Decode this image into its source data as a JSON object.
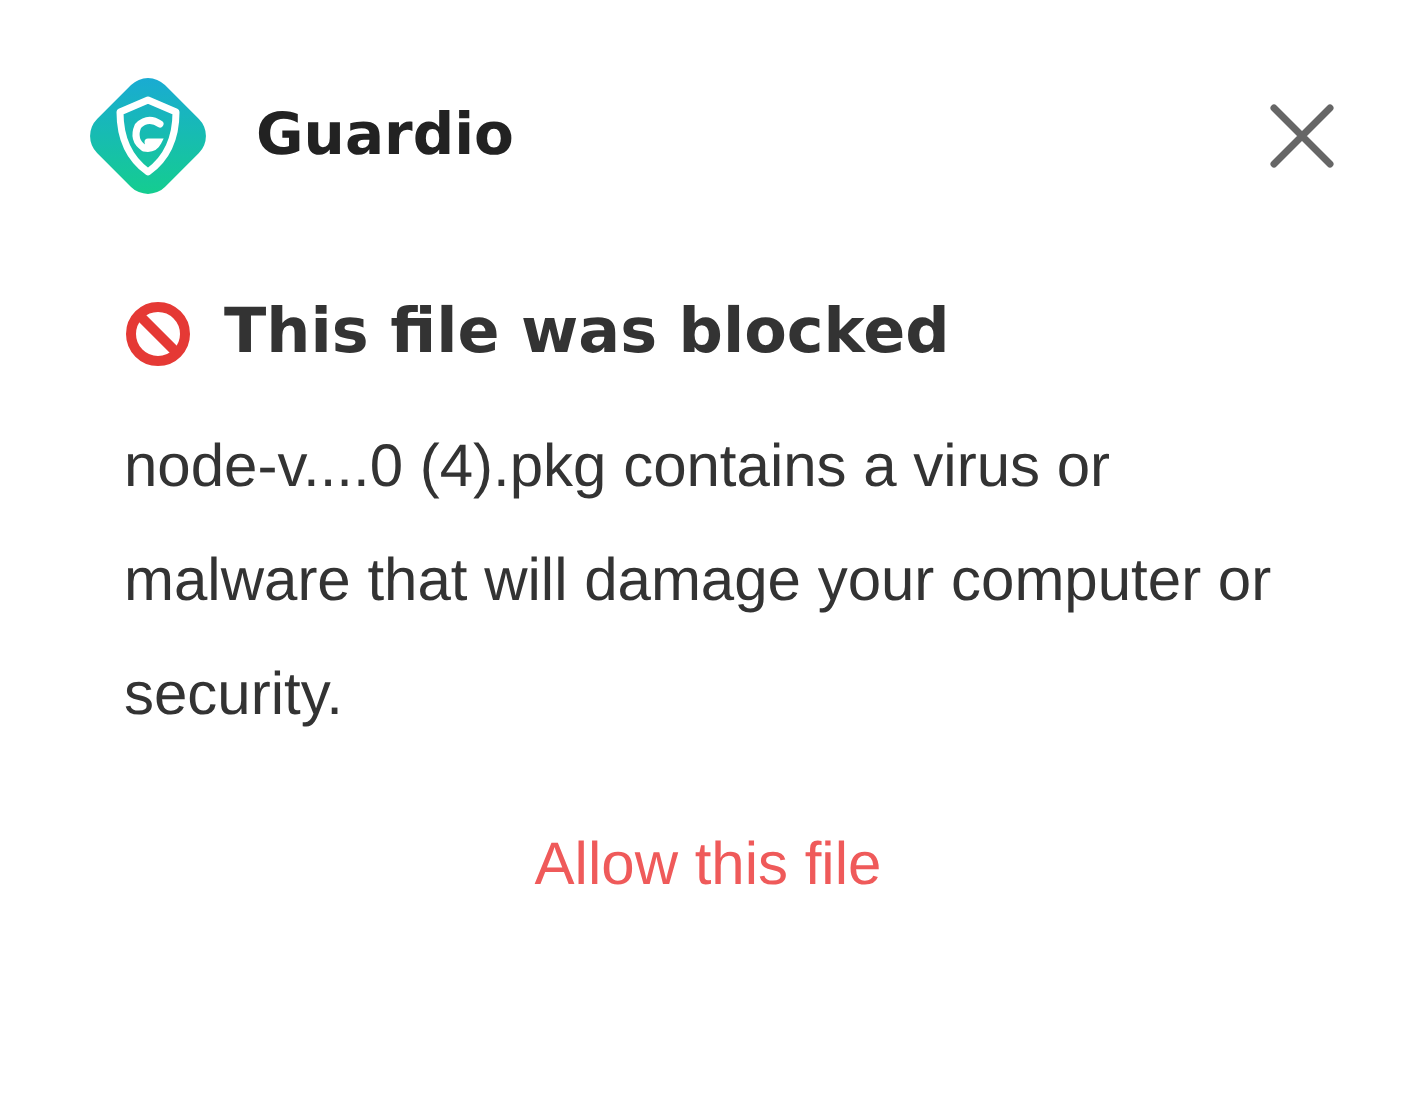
{
  "header": {
    "brand": "Guardio"
  },
  "alert": {
    "title": "This file was blocked",
    "message": "node-v....0 (4).pkg contains a virus or malware that will damage your computer or security."
  },
  "action": {
    "label": "Allow this file"
  }
}
